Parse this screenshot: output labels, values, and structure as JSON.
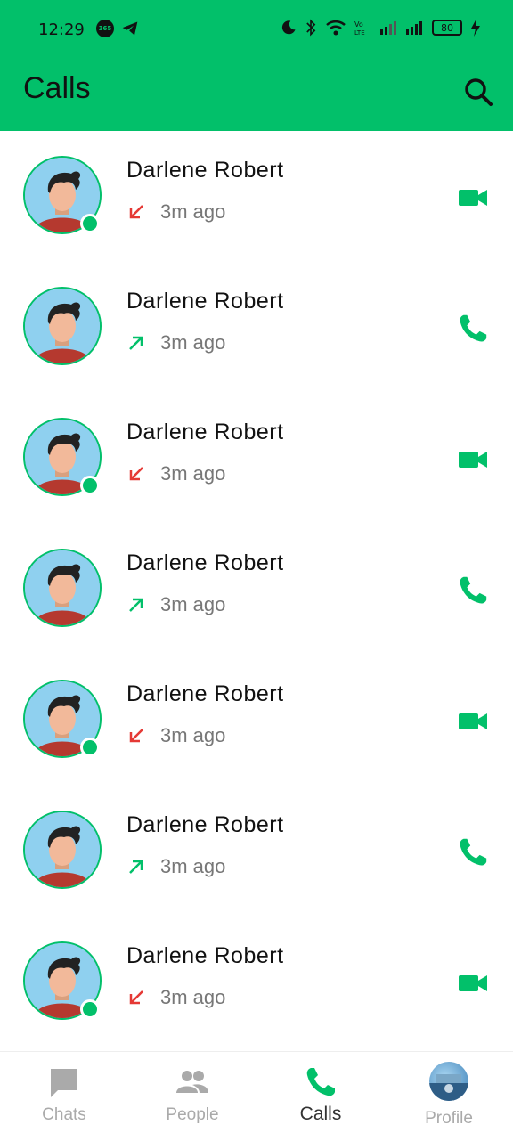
{
  "status_bar": {
    "time": "12:29",
    "battery": "80"
  },
  "header": {
    "title": "Calls"
  },
  "calls": [
    {
      "name": "Darlene Robert",
      "ago": "3m ago",
      "direction": "incoming",
      "type": "video",
      "online": true
    },
    {
      "name": "Darlene Robert",
      "ago": "3m ago",
      "direction": "outgoing",
      "type": "voice",
      "online": false
    },
    {
      "name": "Darlene Robert",
      "ago": "3m ago",
      "direction": "incoming",
      "type": "video",
      "online": true
    },
    {
      "name": "Darlene Robert",
      "ago": "3m ago",
      "direction": "outgoing",
      "type": "voice",
      "online": false
    },
    {
      "name": "Darlene Robert",
      "ago": "3m ago",
      "direction": "incoming",
      "type": "video",
      "online": true
    },
    {
      "name": "Darlene Robert",
      "ago": "3m ago",
      "direction": "outgoing",
      "type": "voice",
      "online": false
    },
    {
      "name": "Darlene Robert",
      "ago": "3m ago",
      "direction": "incoming",
      "type": "video",
      "online": true
    }
  ],
  "nav": [
    {
      "label": "Chats",
      "icon": "chat-icon",
      "active": false
    },
    {
      "label": "People",
      "icon": "people-icon",
      "active": false
    },
    {
      "label": "Calls",
      "icon": "phone-icon",
      "active": true
    },
    {
      "label": "Profile",
      "icon": "profile-avatar",
      "active": false
    }
  ],
  "colors": {
    "accent": "#02c06a",
    "missed": "#e53935",
    "outgoing": "#02c06a"
  }
}
